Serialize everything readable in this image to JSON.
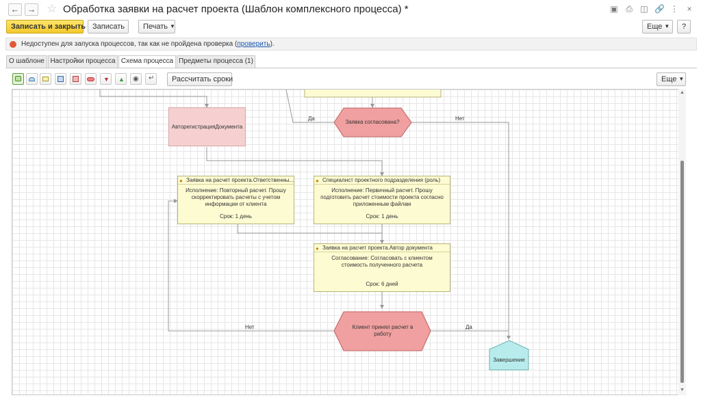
{
  "window": {
    "title": "Обработка заявки на расчет проекта (Шаблон комплексного процесса) *",
    "back_icon": "arrow-left-icon",
    "forward_icon": "arrow-right-icon",
    "favorite_icon": "star-icon"
  },
  "toolbar": {
    "save_close_label": "Записать и закрыть",
    "save_label": "Записать",
    "print_label": "Печать",
    "more_label": "Еще",
    "help_label": "?"
  },
  "warning": {
    "text": "Недоступен для запуска процессов, так как не пройдена проверка (",
    "link": "проверить",
    "suffix": ")."
  },
  "tabs": [
    {
      "label": "О шаблоне"
    },
    {
      "label": "Настройки процесса"
    },
    {
      "label": "Схема процесса",
      "active": true
    },
    {
      "label": "Предметы процесса (1)"
    }
  ],
  "scheme_toolbar": {
    "calc_label": "Рассчитать сроки",
    "more_label": "Еще"
  },
  "diagram": {
    "autoreg": "АвторегистрацияДокумента",
    "cond1": "Заявка согласована?",
    "cond1_yes": "Да",
    "cond1_no": "Нет",
    "task1": {
      "header": "Заявка на расчет проекта.Ответственны...",
      "body": "Исполнение: Повторный расчет. Прошу скорректировать расчеты с учетом информации от клиента",
      "term": "Срок: 1 день"
    },
    "task2": {
      "header": "Специалист проектного подразделения (роль)",
      "body": "Исполнение: Первичный расчет. Прошу подготовить расчет стоимости проекта согласно приложенным файлам",
      "term": "Срок: 1 день"
    },
    "task3": {
      "header": "Заявка на расчет проекта.Автор документа",
      "body": "Согласование: Согласовать с клиентом стоимость полученного расчета",
      "term": "Срок: 6 дней"
    },
    "cond2": "Клиент принял расчет в работу",
    "cond2_no": "Нет",
    "cond2_yes": "Да",
    "end": "Завершение"
  },
  "colors": {
    "task_fill": "#fdfbd2",
    "condition_fill": "#f0a0a0",
    "autoreg_fill": "#f6d0d0",
    "end_fill": "#b8ecec",
    "primary_button": "#f3c82c",
    "warning_dot": "#e05a3a"
  }
}
